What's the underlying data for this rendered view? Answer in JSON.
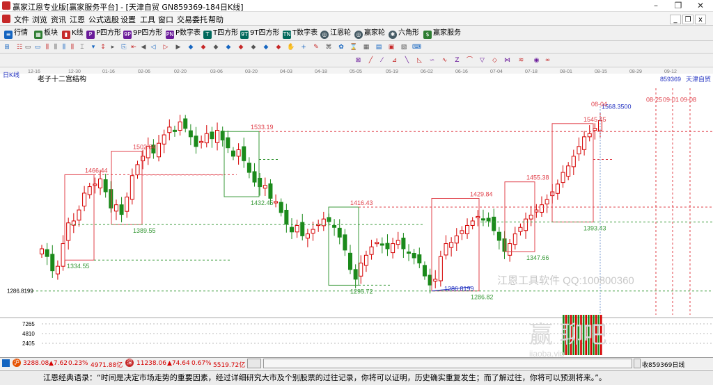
{
  "window": {
    "title": "赢家江恩专业版[赢家服务平台] - [天津自贸  GN859369-184日K线]",
    "min_btn": "–",
    "max_btn": "❐",
    "close_btn": "✕",
    "sub_min": "_",
    "sub_max": "❐",
    "sub_close": "x"
  },
  "menu": [
    "文件",
    "浏览",
    "资讯",
    "江恩",
    "公式选股",
    "设置",
    "工具",
    "窗口",
    "交易委托",
    "帮助"
  ],
  "toolbar1": [
    {
      "icon": "list-icon",
      "label": "行情",
      "color": "#1565c0"
    },
    {
      "icon": "block-icon",
      "label": "板块",
      "color": "#2e7d32"
    },
    {
      "icon": "candle-icon",
      "label": "K线",
      "color": "#c62828"
    },
    {
      "icon": "p-square-icon",
      "label": "P四方形",
      "color": "#6a1b9a",
      "tag": "P"
    },
    {
      "icon": "9p-square-icon",
      "label": "9P四方形",
      "color": "#6a1b9a",
      "tag": "9P"
    },
    {
      "icon": "pn-icon",
      "label": "P数字表",
      "color": "#6a1b9a",
      "tag": "PN"
    },
    {
      "icon": "t-square-icon",
      "label": "T四方形",
      "color": "#00695c",
      "tag": "T"
    },
    {
      "icon": "9t-square-icon",
      "label": "9T四方形",
      "color": "#00695c",
      "tag": "9T"
    },
    {
      "icon": "tn-icon",
      "label": "T数字表",
      "color": "#00695c",
      "tag": "TN"
    },
    {
      "icon": "gann-wheel-icon",
      "label": "江恩轮",
      "color": "#455a64"
    },
    {
      "icon": "winner-wheel-icon",
      "label": "赢家轮",
      "color": "#455a64"
    },
    {
      "icon": "hexagon-icon",
      "label": "六角形",
      "color": "#455a64"
    },
    {
      "icon": "dollar-icon",
      "label": "赢家服务",
      "color": "#2e7d32",
      "tag": "$"
    }
  ],
  "left_label": "日K线",
  "chart_title": "老子十二宫结构",
  "stock_code": "859369",
  "stock_name": "天津自贸",
  "watermark1": "江恩工具软件 QQ:100800360",
  "watermark2": "赢 聊吧",
  "watermark3": "jiaoba.vip",
  "status": {
    "idx1": "3288.08",
    "idx1_chg": "▲7.62",
    "idx1_pct": "0.23%",
    "idx1_amt": "4971.88亿",
    "idx2": "11238.06",
    "idx2_chg": "▲74.64",
    "idx2_pct": "0.67%",
    "idx2_amt": "5519.72亿",
    "right": "收859369日线"
  },
  "quote": "江恩经典语录：“时间是决定市场走势的重要因素，经过详细研究大市及个别股票的过往记录，你将可以证明，历史确实重复发生；而了解过往，你将可以预测将来。”。",
  "colors": {
    "up": "#d50000",
    "down": "#1b8a1b",
    "red_line": "#e0404a",
    "green_line": "#3a9a3a",
    "blue": "#2030c0"
  },
  "chart_data": {
    "type": "candlestick",
    "title": "老子十二宫结构",
    "period": "日K线",
    "x_dates": [
      "12-16",
      "12-30",
      "01-16",
      "02-06",
      "02-20",
      "03-06",
      "03-20",
      "04-03",
      "04-18",
      "05-05",
      "05-19",
      "06-02",
      "06-16",
      "07-04",
      "07-18",
      "08-01",
      "08-15",
      "08-29",
      "09-12"
    ],
    "ylim": [
      1250,
      1600
    ],
    "price_labels": [
      {
        "text": "1466.44",
        "color": "red"
      },
      {
        "text": "1502.84",
        "color": "red"
      },
      {
        "text": "1533.19",
        "color": "red"
      },
      {
        "text": "1416.43",
        "color": "red"
      },
      {
        "text": "1429.84",
        "color": "red"
      },
      {
        "text": "1455.38",
        "color": "red"
      },
      {
        "text": "1545.45",
        "color": "red"
      },
      {
        "text": "1389.55",
        "color": "green"
      },
      {
        "text": "1334.55",
        "color": "green"
      },
      {
        "text": "1432.45",
        "color": "green"
      },
      {
        "text": "1295.72",
        "color": "green"
      },
      {
        "text": "1286.82",
        "color": "green"
      },
      {
        "text": "1347.66",
        "color": "green"
      },
      {
        "text": "1393.43",
        "color": "green"
      },
      {
        "text": "1286.8199",
        "color": "blue"
      },
      {
        "text": "1568.3500",
        "color": "blue"
      }
    ],
    "time_labels": [
      "08-04",
      "08-25",
      "09-01",
      "09-08"
    ],
    "y_axis_ticks": [
      "1286.8199",
      "7265",
      "4810",
      "2405"
    ],
    "series_close": [
      1352,
      1340,
      1318,
      1325,
      1360,
      1392,
      1395,
      1412,
      1438,
      1448,
      1452,
      1460,
      1440,
      1415,
      1420,
      1405,
      1432,
      1465,
      1482,
      1495,
      1510,
      1500,
      1515,
      1528,
      1540,
      1535,
      1548,
      1538,
      1525,
      1510,
      1518,
      1530,
      1522,
      1535,
      1520,
      1508,
      1495,
      1505,
      1488,
      1470,
      1455,
      1448,
      1450,
      1430,
      1425,
      1408,
      1390,
      1378,
      1388,
      1372,
      1375,
      1382,
      1390,
      1398,
      1394,
      1385,
      1370,
      1350,
      1320,
      1305,
      1330,
      1342,
      1355,
      1362,
      1358,
      1352,
      1360,
      1365,
      1352,
      1345,
      1338,
      1330,
      1310,
      1296,
      1305,
      1340,
      1360,
      1362,
      1372,
      1380,
      1388,
      1395,
      1402,
      1398,
      1395,
      1380,
      1365,
      1348,
      1360,
      1375,
      1385,
      1398,
      1404,
      1412,
      1420,
      1428,
      1440,
      1452,
      1470,
      1480,
      1495,
      1510,
      1525,
      1530,
      1538,
      1550
    ]
  }
}
